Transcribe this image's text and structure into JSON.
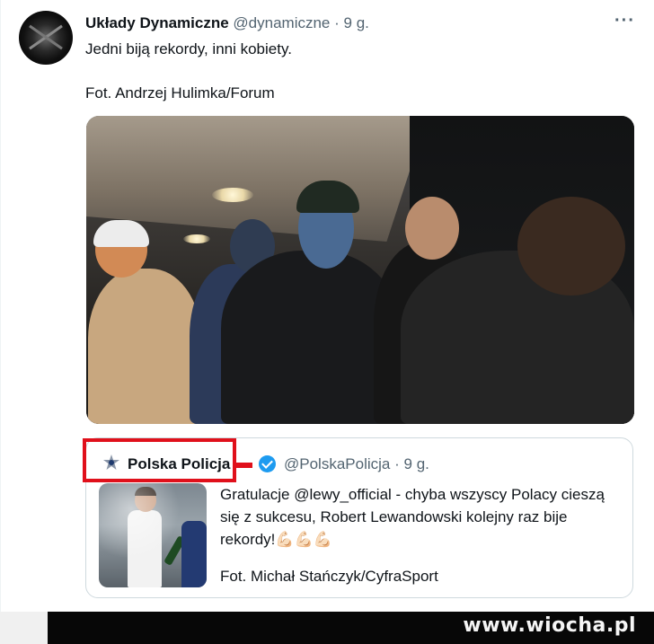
{
  "tweet": {
    "author_name": "Układy Dynamiczne",
    "author_handle": "@dynamiczne",
    "separator": "·",
    "time": "9 g.",
    "more_label": "···",
    "text_line1": "Jedni biją rekordy, inni kobiety.",
    "text_line2": "Fot. Andrzej Hulimka/Forum"
  },
  "quoted": {
    "author_name": "Polska Policja",
    "author_handle": "@PolskaPolicja",
    "separator": "·",
    "time": "9 g.",
    "lines": [
      "Gratulacje @lewy_official - chyba wszyscy Polacy cieszą",
      "się z sukcesu, Robert Lewandowski kolejny raz bije",
      "rekordy!💪🏻💪🏻💪🏻"
    ],
    "credit": "Fot. Michał Stańczyk/CyfraSport"
  },
  "watermark": "www.wiocha.pl",
  "colors": {
    "highlight_box": "#e0101b",
    "verified": "#1d9bf0",
    "secondary_text": "#536471"
  }
}
